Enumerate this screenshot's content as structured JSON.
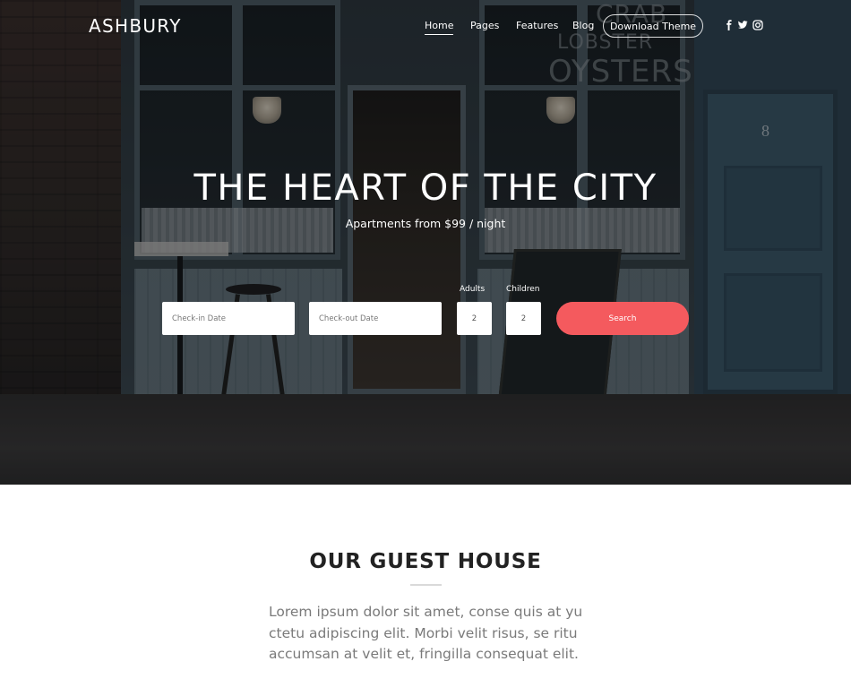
{
  "brand": {
    "logo_text": "ASHBURY"
  },
  "nav": {
    "items": [
      {
        "label": "Home",
        "active": true
      },
      {
        "label": "Pages",
        "active": false
      },
      {
        "label": "Features",
        "active": false
      },
      {
        "label": "Blog",
        "active": false
      }
    ],
    "cta_label": "Download Theme",
    "social_icons": [
      "facebook-icon",
      "twitter-icon",
      "instagram-icon"
    ]
  },
  "hero": {
    "title": "THE HEART OF THE CITY",
    "subtitle": "Apartments from $99 / night",
    "background_image": "storefront-photo",
    "background_text": {
      "neon_line_1": "CRAB",
      "neon_line_2": "LOBSTER",
      "neon_line_3": "OYSTERS",
      "door_number": "8"
    }
  },
  "booking": {
    "checkin_placeholder": "Check-in Date",
    "checkout_placeholder": "Check-out Date",
    "adults_label": "Adults",
    "adults_value": "2",
    "children_label": "Children",
    "children_value": "2",
    "search_label": "Search"
  },
  "guest_house": {
    "title": "OUR GUEST HOUSE",
    "text_lines": [
      "Lorem ipsum dolor sit amet, conse quis at yu",
      "ctetu adipiscing elit. Morbi velit risus, se ritu",
      "accumsan at velit et, fringilla consequat elit."
    ]
  },
  "colors": {
    "accent": "#f45a5e",
    "heading": "#222222",
    "body_text": "#7a7a7a",
    "divider": "#d9d9d9"
  }
}
